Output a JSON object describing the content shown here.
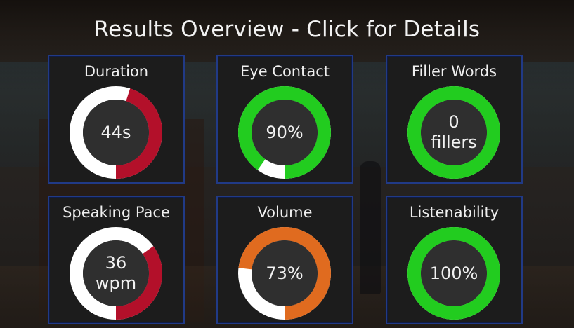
{
  "header": {
    "title": "Results Overview - Click for Details"
  },
  "colors": {
    "red": "#b3102a",
    "green": "#22cc1f",
    "orange": "#e06b1f",
    "track": "#ffffff",
    "inner": "#2f2f2f"
  },
  "metrics": [
    {
      "title": "Duration",
      "value_text": "44s",
      "fraction": 0.45,
      "color": "#b3102a"
    },
    {
      "title": "Eye Contact",
      "value_text": "90%",
      "fraction": 0.9,
      "color": "#22cc1f"
    },
    {
      "title": "Filler Words",
      "value_text": "0\nfillers",
      "fraction": 1.0,
      "color": "#22cc1f"
    },
    {
      "title": "Speaking Pace",
      "value_text": "36\nwpm",
      "fraction": 0.35,
      "color": "#b3102a"
    },
    {
      "title": "Volume",
      "value_text": "73%",
      "fraction": 0.73,
      "color": "#e06b1f"
    },
    {
      "title": "Listenability",
      "value_text": "100%",
      "fraction": 1.0,
      "color": "#22cc1f"
    }
  ]
}
